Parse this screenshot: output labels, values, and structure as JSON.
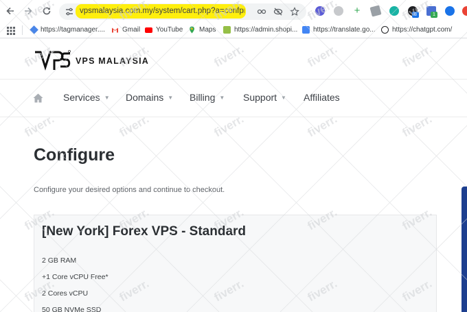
{
  "browser": {
    "url": "vpsmalaysia.com.my/system/cart.php?a=confproduc...",
    "url_highlight_color": "#ffee00",
    "nav_icons": [
      "back-arrow-icon",
      "forward-arrow-icon",
      "reload-icon"
    ],
    "omnibox_icons": [
      "tune-icon",
      "password-key-icon",
      "eye-off-icon",
      "bookmark-star-icon"
    ],
    "extension_badges": [
      "8",
      "1"
    ]
  },
  "bookmarks": [
    {
      "label": "https://tagmanager....",
      "icon": "tag-manager-icon"
    },
    {
      "label": "Gmail",
      "icon": "gmail-icon"
    },
    {
      "label": "YouTube",
      "icon": "youtube-icon"
    },
    {
      "label": "Maps",
      "icon": "maps-icon"
    },
    {
      "label": "https://admin.shopi...",
      "icon": "shopify-icon"
    },
    {
      "label": "https://translate.go...",
      "icon": "translate-icon"
    },
    {
      "label": "https://chatgpt.com/",
      "icon": "chatgpt-icon"
    }
  ],
  "site": {
    "logo_text": "VPS MALAYSIA",
    "nav": [
      {
        "label": "Services",
        "dropdown": true
      },
      {
        "label": "Domains",
        "dropdown": true
      },
      {
        "label": "Billing",
        "dropdown": true
      },
      {
        "label": "Support",
        "dropdown": true
      },
      {
        "label": "Affiliates",
        "dropdown": false
      }
    ],
    "page_title": "Configure",
    "subtitle": "Configure your desired options and continue to checkout.",
    "product": {
      "title": "[New York] Forex VPS - Standard",
      "features": [
        "2 GB RAM",
        "+1 Core vCPU Free*",
        "2 Cores vCPU",
        "50 GB NVMe SSD"
      ]
    },
    "accent_color": "#1d3f8f"
  },
  "watermark_text": "fiverr."
}
